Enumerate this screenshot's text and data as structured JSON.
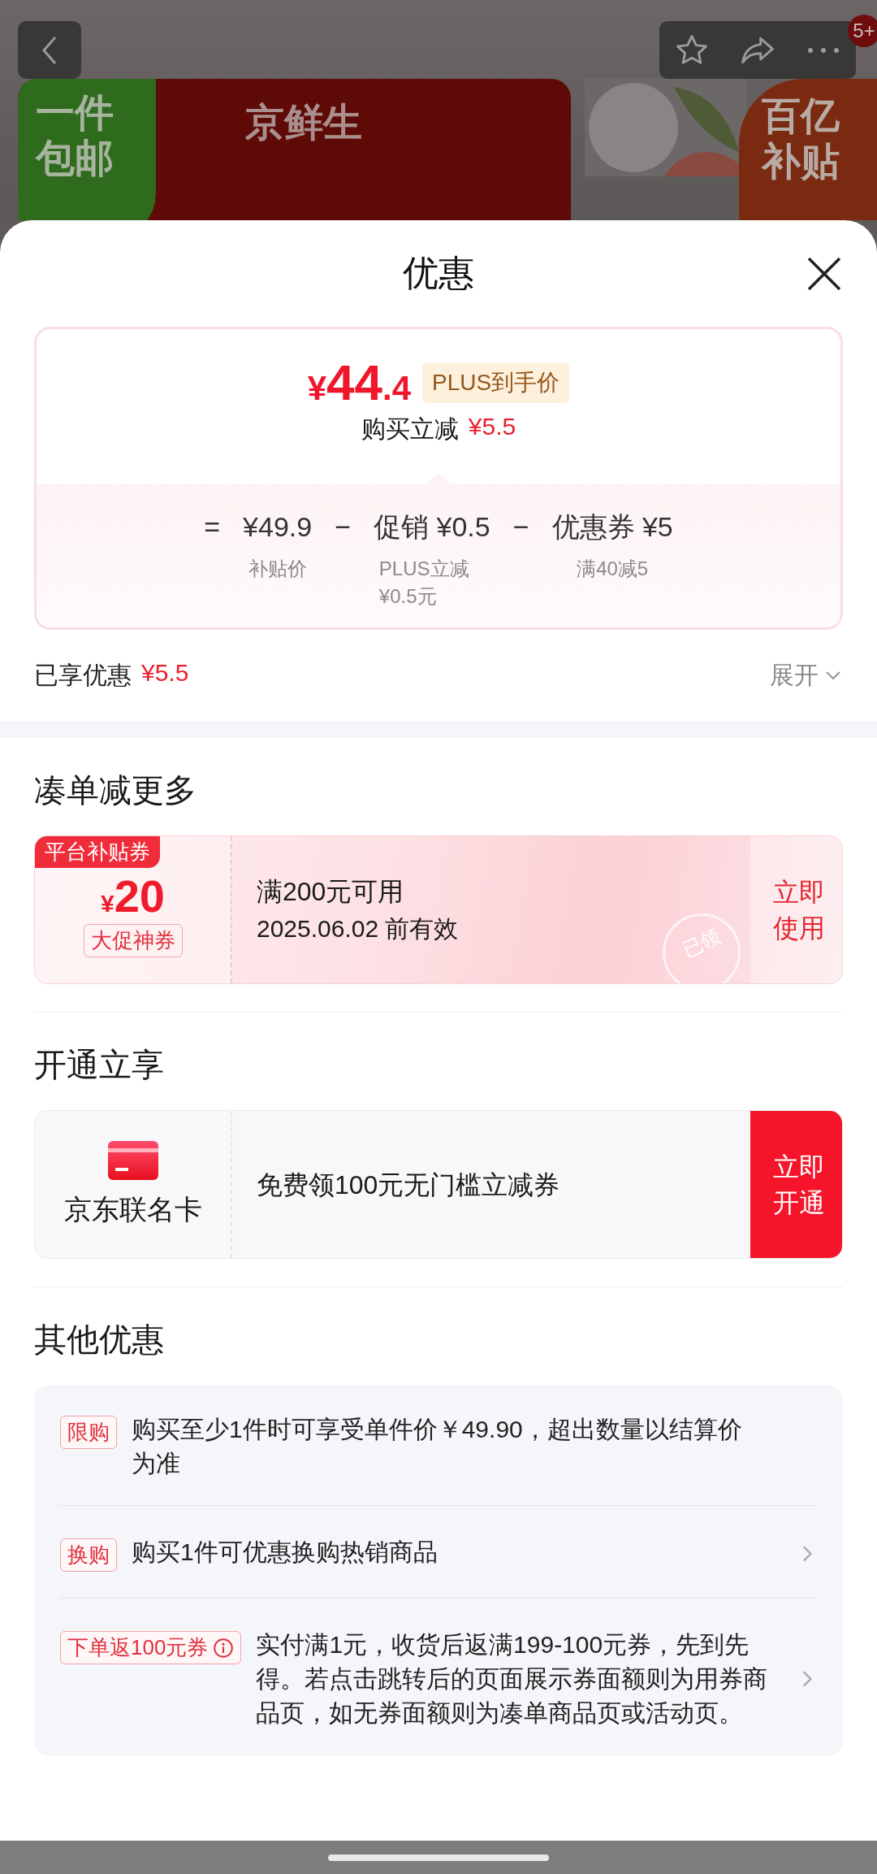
{
  "top_bar": {
    "badge": "5+"
  },
  "banners": {
    "promo_tag": [
      "一件",
      "包邮"
    ],
    "title": "京鲜生",
    "logo": [
      "百亿",
      "补贴"
    ]
  },
  "sheet": {
    "title": "优惠",
    "price_card": {
      "price": {
        "currency": "¥",
        "integer": "44",
        "decimal": ".4"
      },
      "price_tag": "PLUS到手价",
      "instant": {
        "label": "购买立减",
        "amount": "¥5.5"
      },
      "formula": [
        {
          "kind": "operator",
          "text": "="
        },
        {
          "kind": "term",
          "value": "¥49.9",
          "note": "补贴价"
        },
        {
          "kind": "operator",
          "text": "−"
        },
        {
          "kind": "term",
          "value": "促销 ¥0.5",
          "note": "PLUS立减 ¥0.5元"
        },
        {
          "kind": "operator",
          "text": "−"
        },
        {
          "kind": "term",
          "value": "优惠券 ¥5",
          "note": "满40减5"
        }
      ]
    },
    "enjoyed": {
      "label": "已享优惠",
      "amount": "¥5.5",
      "expand": {
        "label": "展开",
        "expanded": false
      }
    },
    "sections": [
      {
        "kind": "coupon",
        "heading": "凑单减更多",
        "tag": "平台补贴券",
        "currency": "¥",
        "amount": "20",
        "badge": "大促神券",
        "condition": "满200元可用",
        "validity": "2025.06.02 前有效",
        "action": "立即使用",
        "stamp": "已领"
      },
      {
        "kind": "card",
        "heading": "开通立享",
        "name": "京东联名卡",
        "offer": "免费领100元无门槛立减券",
        "action": "立即开通"
      },
      {
        "kind": "list",
        "heading": "其他优惠",
        "items": [
          {
            "tag": "限购",
            "info": false,
            "text": "购买至少1件时可享受单件价￥49.90，超出数量以结算价为准",
            "link": false
          },
          {
            "tag": "换购",
            "info": false,
            "text": "购买1件可优惠换购热销商品",
            "link": true
          },
          {
            "tag": "下单返100元券",
            "info": true,
            "text": "实付满1元，收货后返满199-100元券，先到先得。若点击跳转后的页面展示券面额则为用券商品页，如无券面额则为凑单商品页或活动页。",
            "link": true
          }
        ]
      }
    ]
  }
}
